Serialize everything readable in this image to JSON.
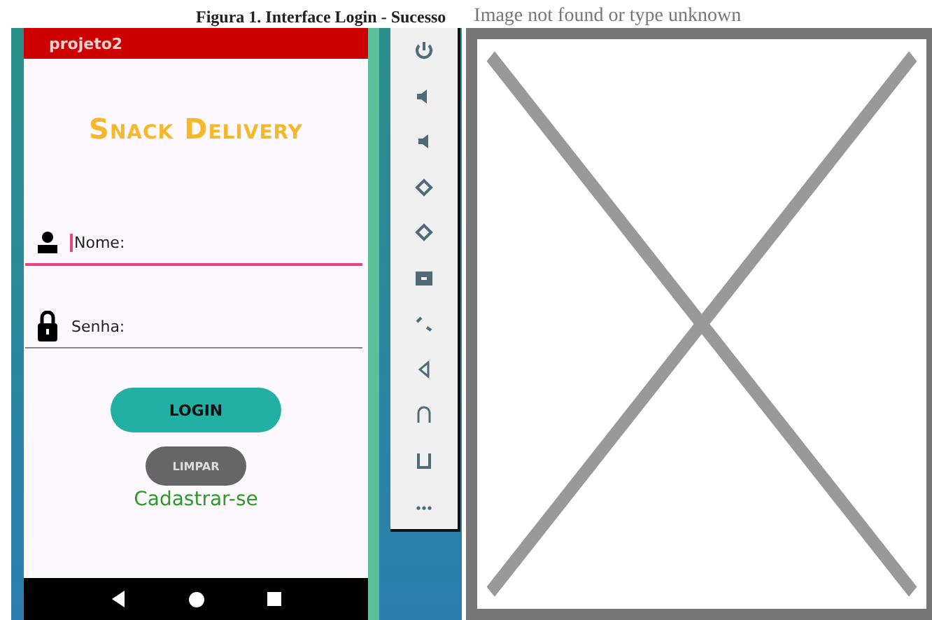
{
  "caption": "Figura 1. Interface Login - Sucesso",
  "broken_image": {
    "alt_text": "Image not found or type unknown"
  },
  "app": {
    "title": "projeto2",
    "heading": "Snack Delivery",
    "fields": [
      {
        "kind": "user",
        "label": "Nome:",
        "focused": true
      },
      {
        "kind": "lock",
        "label": "Senha:",
        "focused": false
      }
    ],
    "buttons": [
      {
        "kind": "primary",
        "label": "LOGIN"
      },
      {
        "kind": "secondary",
        "label": "LIMPAR"
      }
    ],
    "link": "Cadastrar-se"
  }
}
